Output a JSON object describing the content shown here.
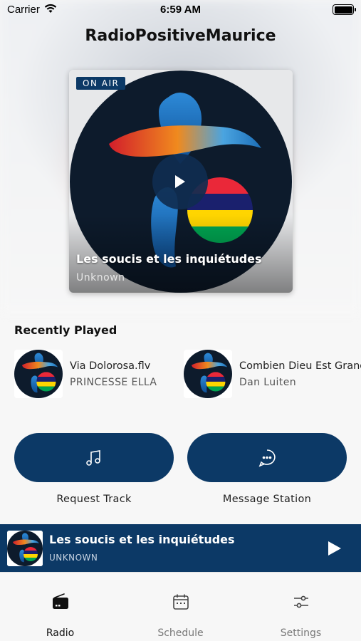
{
  "status_bar": {
    "carrier": "Carrier",
    "time": "6:59 AM"
  },
  "header": {
    "title": "RadioPositiveMaurice"
  },
  "now_playing": {
    "badge": "ON AIR",
    "title": "Les soucis et les inquiétudes",
    "artist": "Unknown",
    "icons": {
      "play": "play-icon"
    }
  },
  "recently_played": {
    "heading": "Recently Played",
    "items": [
      {
        "title": "Via Dolorosa.flv",
        "artist": "PRINCESSE ELLA"
      },
      {
        "title": "Combien Dieu Est Grand",
        "artist": "Dan Luiten"
      }
    ]
  },
  "actions": [
    {
      "label": "Request Track",
      "icon": "music-note-icon"
    },
    {
      "label": "Message Station",
      "icon": "chat-bubble-icon"
    }
  ],
  "mini_player": {
    "title": "Les soucis et les inquiétudes",
    "artist": "UNKNOWN"
  },
  "tabs": [
    {
      "label": "Radio",
      "icon": "radio-icon",
      "active": true
    },
    {
      "label": "Schedule",
      "icon": "calendar-icon",
      "active": false
    },
    {
      "label": "Settings",
      "icon": "sliders-icon",
      "active": false
    }
  ],
  "colors": {
    "brand": "#0c3966",
    "background": "#f7f7f7"
  }
}
